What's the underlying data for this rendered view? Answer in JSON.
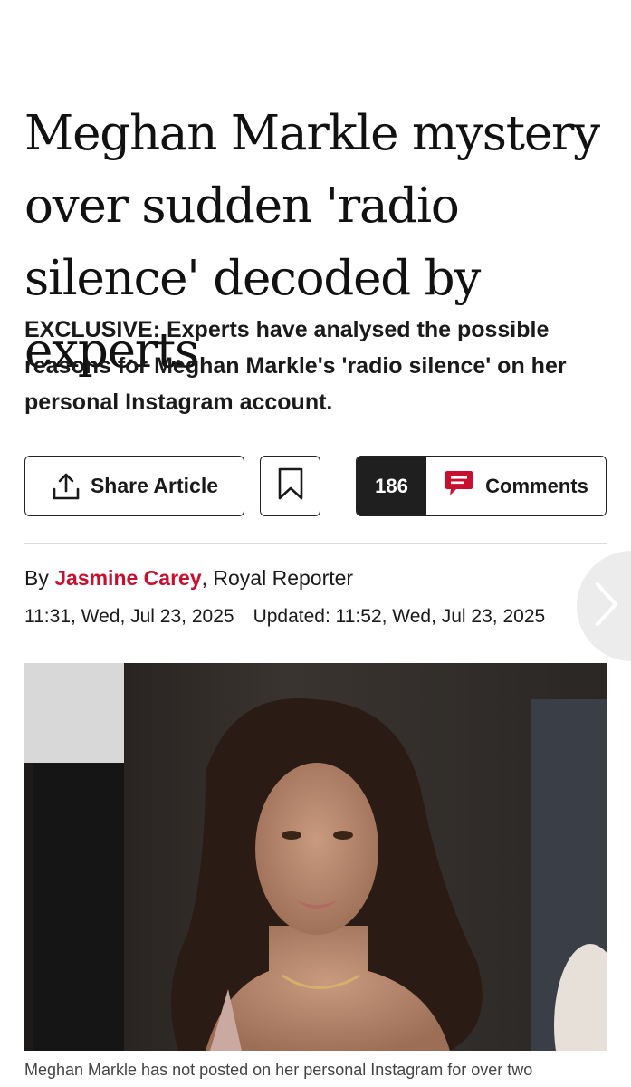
{
  "article": {
    "headline": "Meghan Markle mystery over sudden 'radio silence' decoded by experts",
    "standfirst": "EXCLUSIVE: Experts have analysed the possible reasons for Meghan Markle's 'radio silence' on her personal Instagram account.",
    "caption": "Meghan Markle has not posted on her personal Instagram for over two"
  },
  "actions": {
    "share_label": "Share Article",
    "comments_count": "186",
    "comments_label": "Comments",
    "accent_color": "#c8102e"
  },
  "byline": {
    "prefix": "By ",
    "author": "Jasmine Carey",
    "role": ", Royal Reporter",
    "published": "11:31, Wed, Jul 23, 2025",
    "updated": "Updated: 11:52, Wed, Jul 23, 2025"
  },
  "icons": {
    "share": "share-upload-icon",
    "bookmark": "bookmark-icon",
    "comments": "speech-bubble-icon",
    "next": "chevron-right-icon"
  }
}
